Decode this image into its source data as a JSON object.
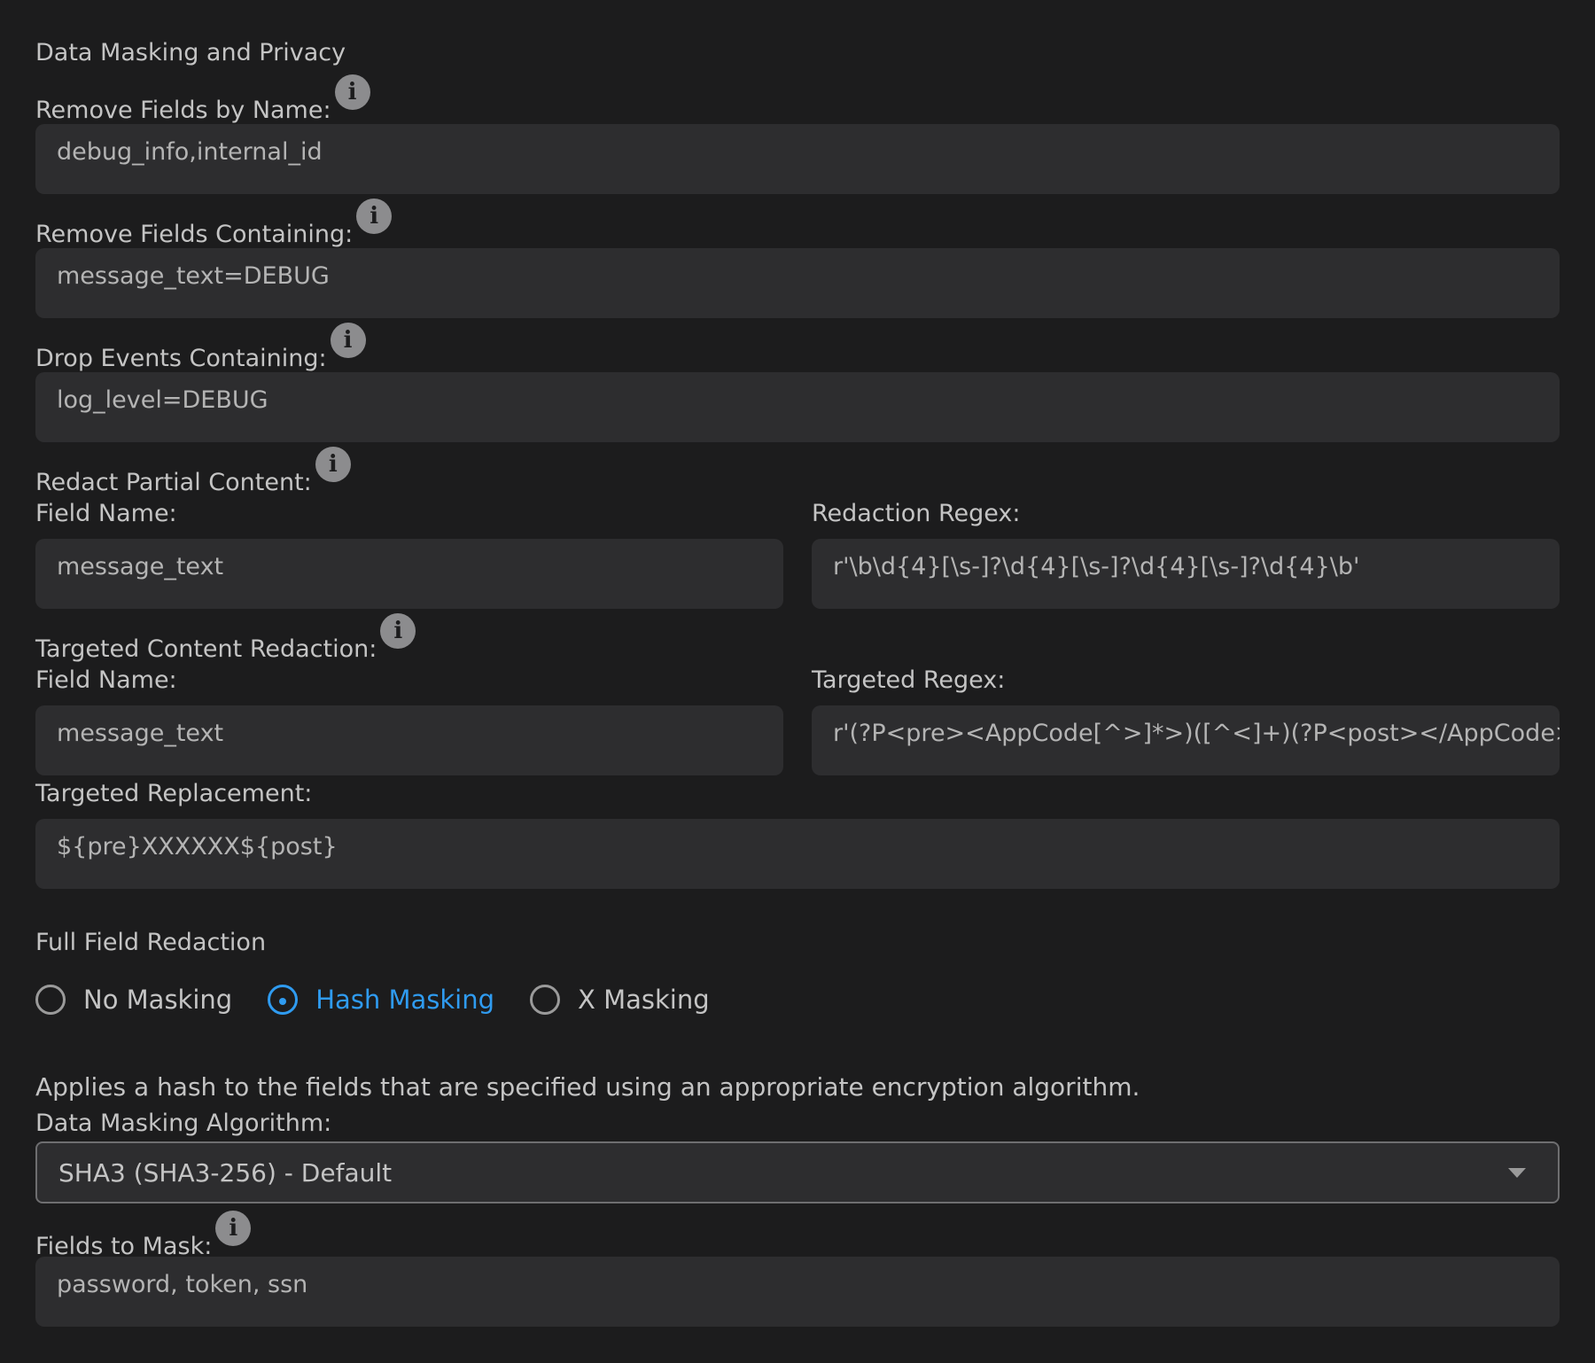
{
  "section_title": "Data Masking and Privacy",
  "remove_by_name": {
    "label": "Remove Fields by Name:",
    "value": "debug_info,internal_id"
  },
  "remove_containing": {
    "label": "Remove Fields Containing:",
    "value": "message_text=DEBUG"
  },
  "drop_events": {
    "label": "Drop Events Containing:",
    "value": "log_level=DEBUG"
  },
  "redact_partial": {
    "label": "Redact Partial Content:",
    "field_name_label": "Field Name:",
    "field_name_value": "message_text",
    "regex_label": "Redaction Regex:",
    "regex_value": "r'\\b\\d{4}[\\s-]?\\d{4}[\\s-]?\\d{4}[\\s-]?\\d{4}\\b'"
  },
  "targeted_redaction": {
    "label": "Targeted Content Redaction:",
    "field_name_label": "Field Name:",
    "field_name_value": "message_text",
    "regex_label": "Targeted Regex:",
    "regex_value": "r'(?P<pre><AppCode[^>]*>)([^<]+)(?P<post></AppCode>)'",
    "replacement_label": "Targeted Replacement:",
    "replacement_value": "${pre}XXXXXX${post}"
  },
  "full_field_redaction": {
    "title": "Full Field Redaction",
    "options": [
      {
        "label": "No Masking",
        "checked": false
      },
      {
        "label": "Hash Masking",
        "checked": true
      },
      {
        "label": "X Masking",
        "checked": false
      }
    ],
    "description": "Applies a hash to the fields that are specified using an appropriate encryption algorithm."
  },
  "algorithm": {
    "label": "Data Masking Algorithm:",
    "selected": "SHA3 (SHA3-256) - Default"
  },
  "fields_to_mask": {
    "label": "Fields to Mask:",
    "value": "password, token, ssn"
  },
  "colors": {
    "background": "#1c1c1d",
    "field_bg": "#2d2d2f",
    "accent": "#2f9bf0",
    "info_icon": "#8c8c8e"
  }
}
